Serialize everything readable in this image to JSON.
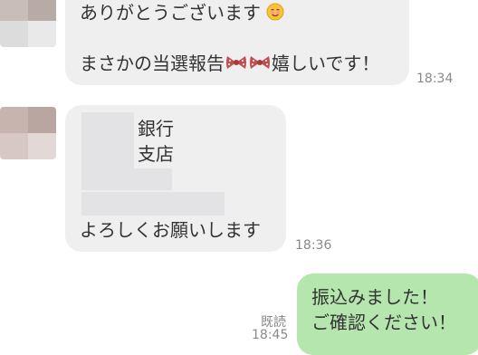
{
  "messages": [
    {
      "line1": "ありがとうございます",
      "line1_emoji": "smiling-face-emoji",
      "line2_prefix": "まさかの当選報告",
      "line2_emoji": "ribbon-bow-emoji x2",
      "line2_suffix": "嬉しいです！",
      "time": "18:34"
    },
    {
      "bank_label": "銀行",
      "branch_label": "支店",
      "closing": "よろしくお願いします",
      "time": "18:36"
    },
    {
      "line1": "振込みました！",
      "line2": "ご確認ください！",
      "read_label": "既読",
      "time": "18:45"
    }
  ],
  "colors": {
    "incoming_bubble": "#efefef",
    "outgoing_bubble": "#b4e6ad",
    "timestamp": "#8a8a8a"
  }
}
